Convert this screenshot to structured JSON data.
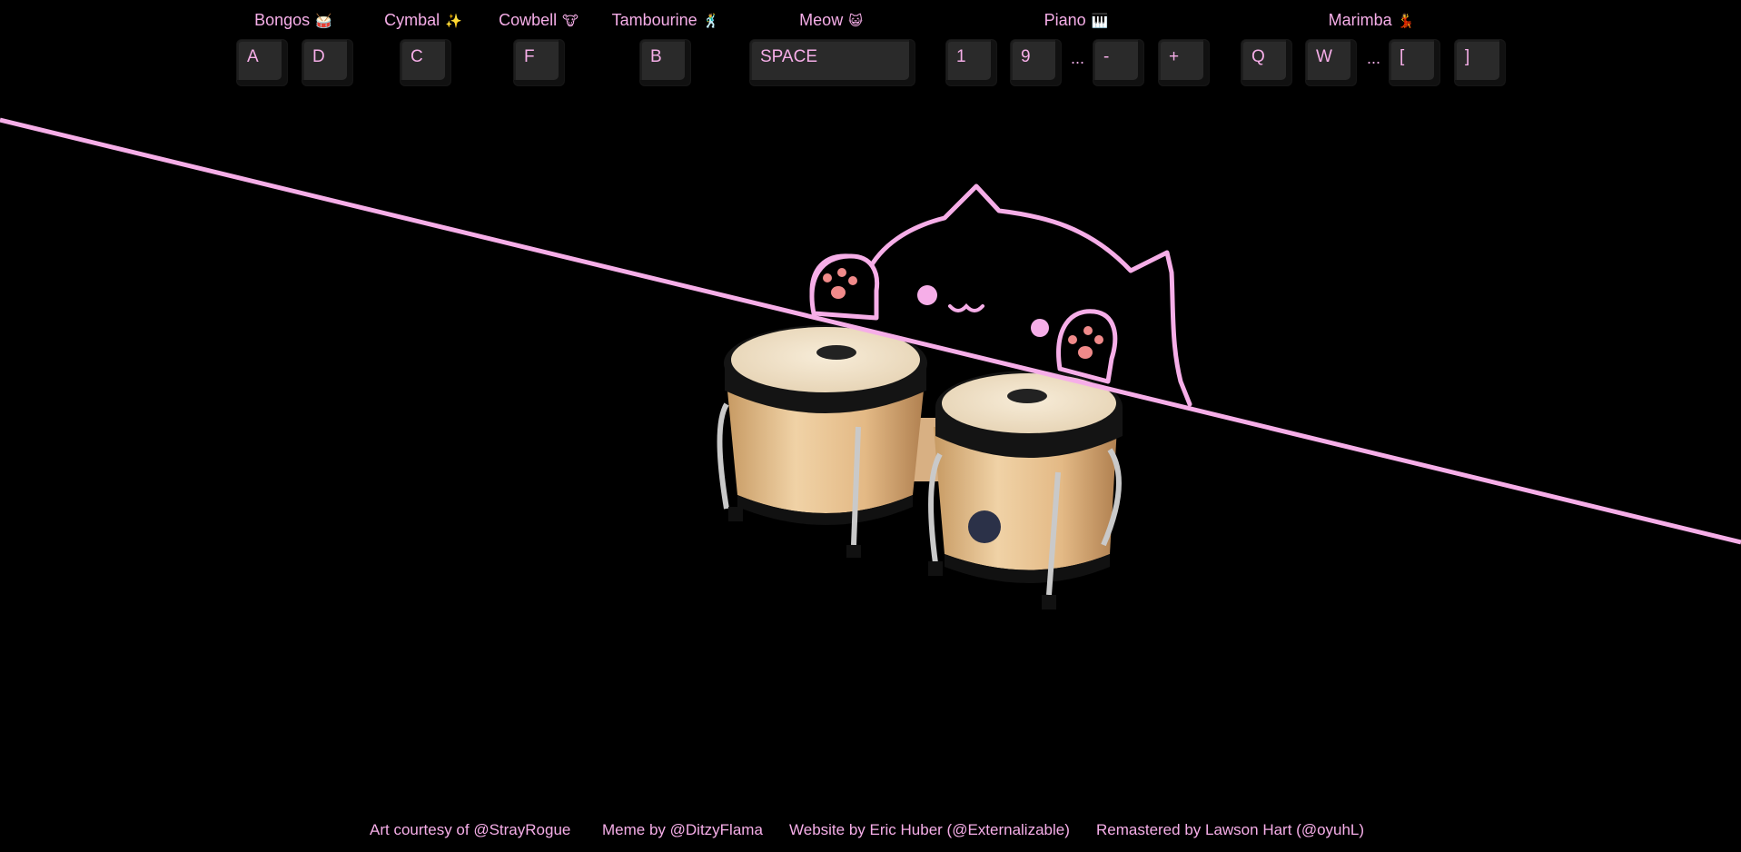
{
  "groups": [
    {
      "label": "Bongos",
      "emoji": "🥁",
      "keys": [
        "A",
        "D"
      ]
    },
    {
      "label": "Cymbal",
      "emoji": "✨",
      "keys": [
        "C"
      ]
    },
    {
      "label": "Cowbell",
      "emoji": "🐮",
      "keys": [
        "F"
      ]
    },
    {
      "label": "Tambourine",
      "emoji": "🕺",
      "keys": [
        "B"
      ]
    },
    {
      "label": "Meow",
      "emoji": "😺",
      "keys": [
        "SPACE"
      ]
    },
    {
      "label": "Piano",
      "emoji": "🎹",
      "keys": [
        "1",
        "9",
        "-",
        "+"
      ],
      "ellipsis": "..."
    },
    {
      "label": "Marimba",
      "emoji": "💃",
      "keys": [
        "Q",
        "W",
        "[",
        "]"
      ],
      "ellipsis": "..."
    }
  ],
  "footer": {
    "art": "Art courtesy of @StrayRogue",
    "meme": "Meme by @DitzyFlama",
    "website": "Website by Eric Huber (@Externalizable)",
    "remaster": "Remastered by Lawson Hart (@oyuhL)"
  },
  "colors": {
    "accent": "#f6aee8",
    "background": "#000000",
    "key": "#2a2a2a"
  }
}
